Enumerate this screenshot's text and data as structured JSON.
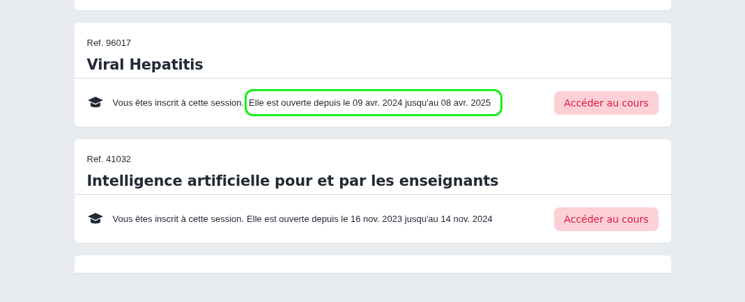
{
  "courses": [
    {
      "ref": "Ref. 96017",
      "title": "Viral Hepatitis",
      "notice": "Vous êtes inscrit à cette session.",
      "period": {
        "text": "Elle est ouverte depuis le 09 avr. 2024 jusqu'au 08 avr. 2025",
        "highlighted": true
      },
      "button": "Accéder au cours"
    },
    {
      "ref": "Ref. 41032",
      "title": "Intelligence artificielle pour et par les enseignants",
      "notice": "Vous êtes inscrit à cette session.",
      "period": {
        "text": "Elle est ouverte depuis le 16 nov. 2023 jusqu'au 14 nov. 2024",
        "highlighted": false
      },
      "button": "Accéder au cours"
    }
  ]
}
